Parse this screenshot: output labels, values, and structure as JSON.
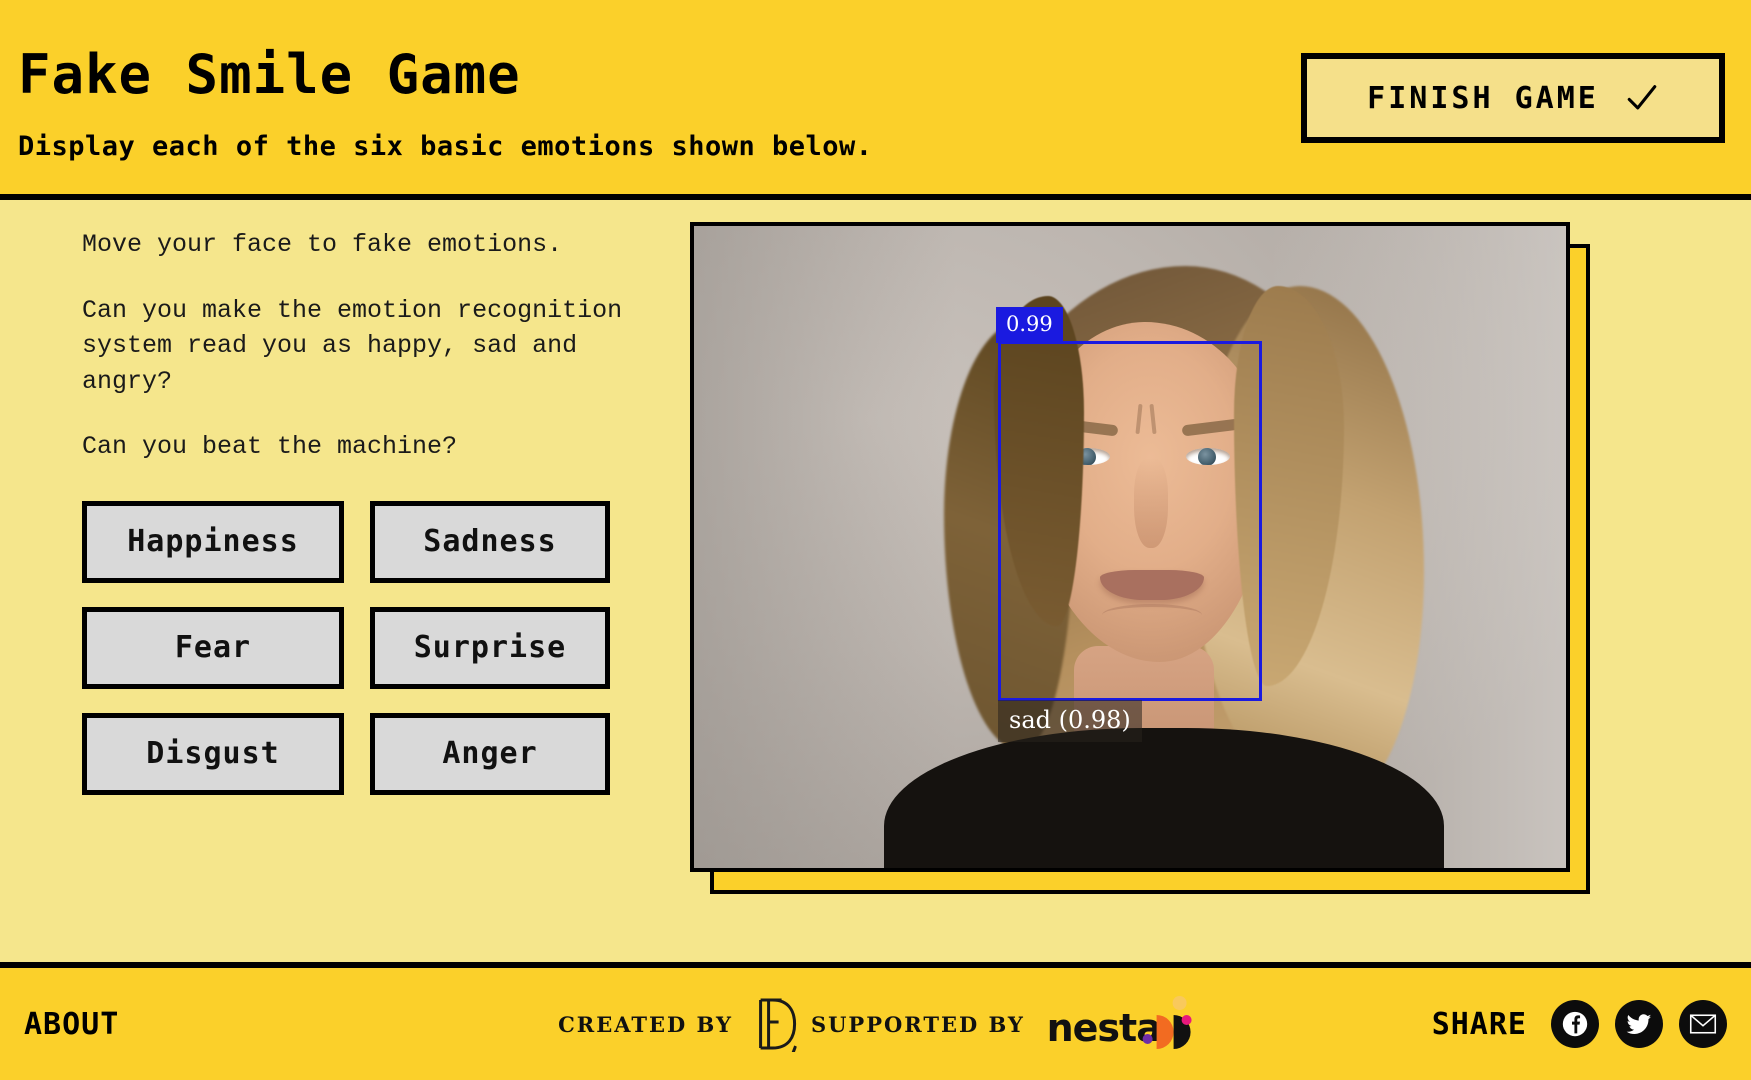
{
  "header": {
    "title": "Fake Smile Game",
    "subtitle": "Display each of the six basic emotions shown below.",
    "finish_button": {
      "label": "FINISH GAME",
      "icon": "check-icon"
    }
  },
  "main": {
    "intro": [
      "Move your face to fake emotions.",
      "Can you make the emotion recognition system read you as happy, sad and angry?",
      "Can you beat the machine?"
    ],
    "emotions": [
      {
        "label": "Happiness"
      },
      {
        "label": "Sadness"
      },
      {
        "label": "Fear"
      },
      {
        "label": "Surprise"
      },
      {
        "label": "Disgust"
      },
      {
        "label": "Anger"
      }
    ],
    "video": {
      "detection_score": "0.99",
      "emotion_label": "sad (0.98)",
      "box_color": "#1a1ae0"
    }
  },
  "footer": {
    "about_label": "ABOUT",
    "created_by_label": "CREATED BY",
    "supported_by_label": "SUPPORTED BY",
    "creator_logo": "d-monogram-logo",
    "supporter_logo": "nesta-logo",
    "share_label": "SHARE",
    "social": [
      {
        "name": "facebook-icon"
      },
      {
        "name": "twitter-icon"
      },
      {
        "name": "email-icon"
      }
    ]
  },
  "colors": {
    "header_yellow": "#FBD02A",
    "body_yellow": "#F5E68C",
    "button_gray": "#D9D9D9",
    "detection_blue": "#1a1ae0",
    "nesta_orange": "#F26B21",
    "nesta_pink": "#E8197D",
    "nesta_purple": "#6F2DA8"
  }
}
